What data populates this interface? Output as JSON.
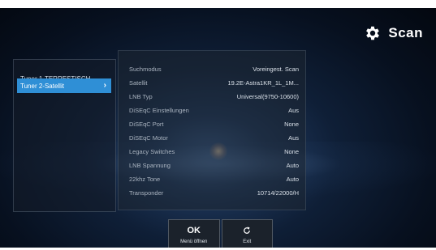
{
  "header": {
    "title": "Scan",
    "icon": "gear-icon"
  },
  "tuners": [
    {
      "label": "Tuner 1-TERRESTISCH",
      "selected": false
    },
    {
      "label": "Tuner 2-Satellit",
      "selected": true,
      "arrow": "›"
    }
  ],
  "settings": [
    {
      "label": "Suchmodus",
      "value": "Voreingest. Scan"
    },
    {
      "label": "Satellit",
      "value": "19.2E-Astra1KR_1L_1M..."
    },
    {
      "label": "LNB Typ",
      "value": "Universal(9750-10600)"
    },
    {
      "label": "DiSEqC Einstellungen",
      "value": "Aus"
    },
    {
      "label": "DiSEqC Port",
      "value": "None"
    },
    {
      "label": "DiSEqC Motor",
      "value": "Aus"
    },
    {
      "label": "Legacy Switches",
      "value": "None"
    },
    {
      "label": "LNB Spannung",
      "value": "Auto"
    },
    {
      "label": "22khz Tone",
      "value": "Auto"
    },
    {
      "label": "Transponder",
      "value": "10714/22000/H"
    }
  ],
  "buttons": [
    {
      "key": "OK",
      "label": "Menü öffnen"
    },
    {
      "key_icon": "refresh-icon",
      "label": "Exit"
    }
  ],
  "colors": {
    "accent": "#2f8fd6",
    "background": "#0f1f37"
  }
}
